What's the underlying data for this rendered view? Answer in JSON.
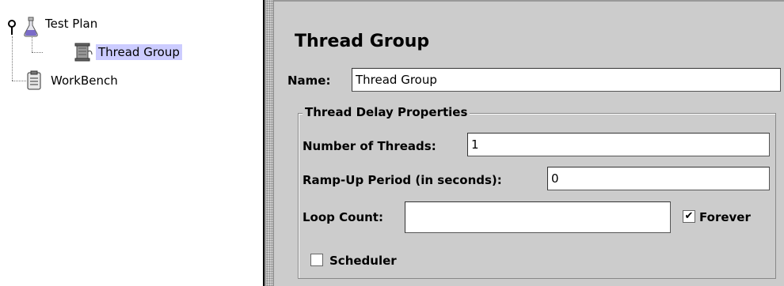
{
  "tree": {
    "items": [
      {
        "label": "Test Plan"
      },
      {
        "label": "Thread Group"
      },
      {
        "label": "WorkBench"
      }
    ]
  },
  "panel": {
    "title": "Thread Group",
    "name_label": "Name:",
    "name_value": "Thread Group",
    "group_title": "Thread Delay Properties",
    "threads_label": "Number of Threads:",
    "threads_value": "1",
    "rampup_label": "Ramp-Up Period (in seconds):",
    "rampup_value": "0",
    "loop_label": "Loop Count:",
    "loop_value": "",
    "forever_label": "Forever",
    "forever_checked": true,
    "scheduler_label": "Scheduler",
    "scheduler_checked": false,
    "check_mark": "✔"
  },
  "colors": {
    "panel_bg": "#cccccc",
    "selection": "#ccccff"
  }
}
